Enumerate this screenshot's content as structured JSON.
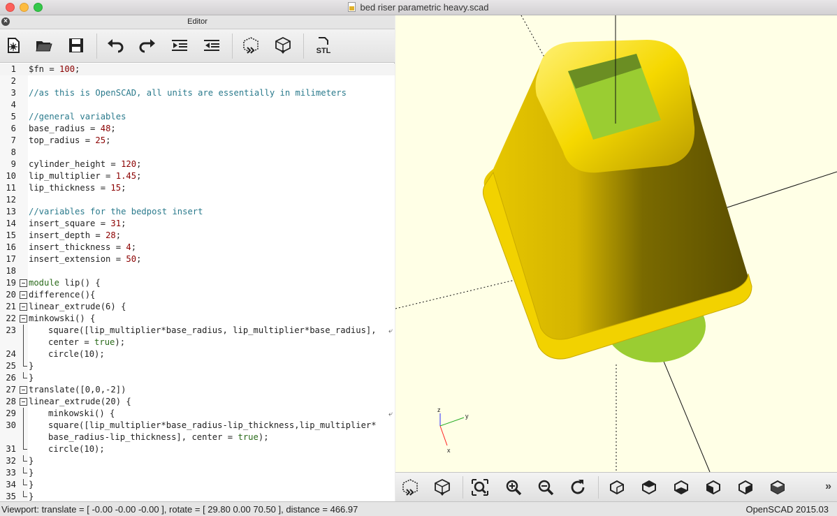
{
  "window": {
    "title": "bed riser parametric heavy.scad"
  },
  "editor": {
    "title": "Editor",
    "close_glyph": "×",
    "toolbar": [
      "new-file-icon",
      "open-file-icon",
      "save-icon",
      "undo-icon",
      "redo-icon",
      "unindent-icon",
      "indent-icon",
      "preview-icon",
      "render-icon",
      "export-stl-icon"
    ],
    "export_label": "STL",
    "lines": [
      {
        "n": "1",
        "text": "$fn = 100;"
      },
      {
        "n": "2",
        "text": ""
      },
      {
        "n": "3",
        "text": "//as this is OpenSCAD, all units are essentially in milimeters"
      },
      {
        "n": "4",
        "text": ""
      },
      {
        "n": "5",
        "text": "//general variables"
      },
      {
        "n": "6",
        "text": "base_radius = 48;"
      },
      {
        "n": "7",
        "text": "top_radius = 25;"
      },
      {
        "n": "8",
        "text": ""
      },
      {
        "n": "9",
        "text": "cylinder_height = 120;"
      },
      {
        "n": "10",
        "text": "lip_multiplier = 1.45;"
      },
      {
        "n": "11",
        "text": "lip_thickness = 15;"
      },
      {
        "n": "12",
        "text": ""
      },
      {
        "n": "13",
        "text": "//variables for the bedpost insert"
      },
      {
        "n": "14",
        "text": "insert_square = 31;"
      },
      {
        "n": "15",
        "text": "insert_depth = 28;"
      },
      {
        "n": "16",
        "text": "insert_thickness = 4;"
      },
      {
        "n": "17",
        "text": "insert_extension = 50;"
      },
      {
        "n": "18",
        "text": ""
      },
      {
        "n": "19",
        "text": "module lip() {"
      },
      {
        "n": "20",
        "text": "difference(){"
      },
      {
        "n": "21",
        "text": "linear_extrude(6) {"
      },
      {
        "n": "22",
        "text": "minkowski() {"
      },
      {
        "n": "23",
        "text": "square([lip_multiplier*base_radius, lip_multiplier*base_radius],"
      },
      {
        "n": "",
        "text": "center = true);"
      },
      {
        "n": "24",
        "text": "circle(10);"
      },
      {
        "n": "25",
        "text": "}"
      },
      {
        "n": "26",
        "text": "}"
      },
      {
        "n": "27",
        "text": "translate([0,0,-2])"
      },
      {
        "n": "28",
        "text": "linear_extrude(20) {"
      },
      {
        "n": "29",
        "text": "minkowski() {"
      },
      {
        "n": "30",
        "text": "square([lip_multiplier*base_radius-lip_thickness,lip_multiplier*"
      },
      {
        "n": "",
        "text": "base_radius-lip_thickness], center = true);"
      },
      {
        "n": "31",
        "text": "circle(10);"
      },
      {
        "n": "32",
        "text": "}"
      },
      {
        "n": "33",
        "text": "}"
      },
      {
        "n": "34",
        "text": "}"
      },
      {
        "n": "35",
        "text": "}"
      }
    ]
  },
  "viewer": {
    "axes": {
      "x": "x",
      "y": "y",
      "z": "z"
    },
    "model_color": "#f0d000",
    "base_color": "#9acd32",
    "background": "#ffffe6",
    "toolbar": [
      "preview-icon",
      "render-icon",
      "zoom-all-icon",
      "zoom-in-icon",
      "zoom-out-icon",
      "reset-view-icon",
      "view-right-icon",
      "view-top-icon",
      "view-bottom-icon",
      "view-left-icon",
      "view-front-icon",
      "view-back-icon"
    ],
    "more": "»"
  },
  "status": {
    "viewport": "Viewport: translate = [ -0.00 -0.00 -0.00 ], rotate = [ 29.80 0.00 70.50 ], distance = 466.97",
    "version": "OpenSCAD 2015.03"
  }
}
